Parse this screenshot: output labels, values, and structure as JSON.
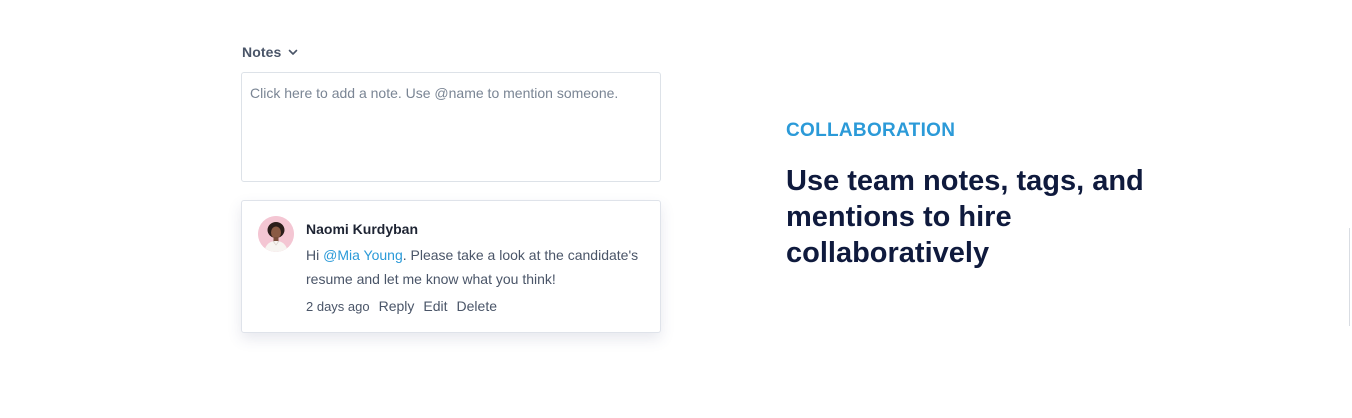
{
  "notes": {
    "header_label": "Notes",
    "input_placeholder": "Click here to add a note. Use @name to mention someone.",
    "input_value": ""
  },
  "comment": {
    "author": "Naomi Kurdyban",
    "greeting": "Hi ",
    "mention": "@Mia Young",
    "text": ". Please take a look at the candidate's resume and let me know what you think!",
    "timestamp": "2 days ago",
    "actions": {
      "reply": "Reply",
      "edit": "Edit",
      "delete": "Delete"
    }
  },
  "feature": {
    "eyebrow": "COLLABORATION",
    "headline": "Use team notes, tags, and mentions to hire collaboratively"
  },
  "colors": {
    "accent": "#2b9ad8",
    "headline": "#0f1a3d",
    "text": "#4a5568",
    "border": "#dde2e8"
  },
  "icons": {
    "notes_toggle": "chevron-down-icon",
    "avatar": "user-avatar-photo"
  }
}
